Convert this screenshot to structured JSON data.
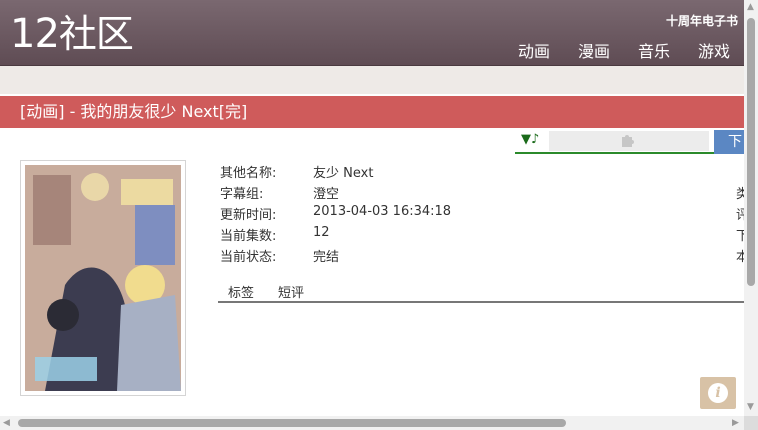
{
  "header": {
    "logo_num": "12",
    "logo_text": "社区",
    "anniversary": "十周年电子书",
    "nav": [
      "动画",
      "漫画",
      "音乐",
      "游戏"
    ]
  },
  "title": "[动画] - 我的朋友很少 Next[完]",
  "player": {
    "music_icon": "▼♪",
    "download_label": "下"
  },
  "details": [
    {
      "label": "其他名称:",
      "value": "友少 Next",
      "edge": "类"
    },
    {
      "label": "字幕组:",
      "value": "澄空",
      "edge": "评"
    },
    {
      "label": "更新时间:",
      "value": "2013-04-03 16:34:18",
      "edge": "下"
    },
    {
      "label": "当前集数:",
      "value": "12",
      "edge": "本"
    },
    {
      "label": "当前状态:",
      "value": "完结",
      "edge": ""
    }
  ],
  "tabs": [
    "标签",
    "短评"
  ],
  "info_button": "i",
  "colors": {
    "header_bg": "#6e5c64",
    "title_bar": "#cf5b5b",
    "download_btn": "#5b87c3",
    "player_line": "#2b8a2b"
  }
}
